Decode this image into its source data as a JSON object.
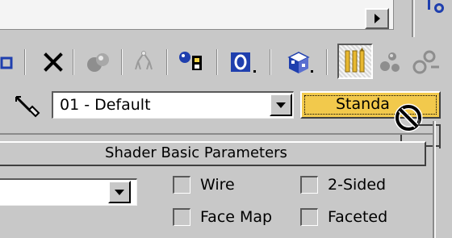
{
  "material": {
    "name": "01 - Default",
    "type_button": "Standa"
  },
  "rollout": {
    "title": "Shader Basic Parameters"
  },
  "options": {
    "wire": {
      "label": "Wire",
      "checked": false
    },
    "two_sided": {
      "label": "2-Sided",
      "checked": false
    },
    "face_map": {
      "label": "Face Map",
      "checked": false
    },
    "faceted": {
      "label": "Faceted",
      "checked": false
    }
  },
  "colors": {
    "panel_bg": "#c8c8c8",
    "active_button": "#f2c94c",
    "accent_blue": "#1f3fae"
  },
  "toolbar": {
    "icons": [
      "put-to-scene-icon",
      "delete-icon",
      "make-unique-icon",
      "put-to-library-icon",
      "material-effects-channel-icon",
      "show-map-in-viewport-icon",
      "show-end-result-icon",
      "go-to-parent-icon",
      "go-forward-to-sibling-icon"
    ]
  }
}
